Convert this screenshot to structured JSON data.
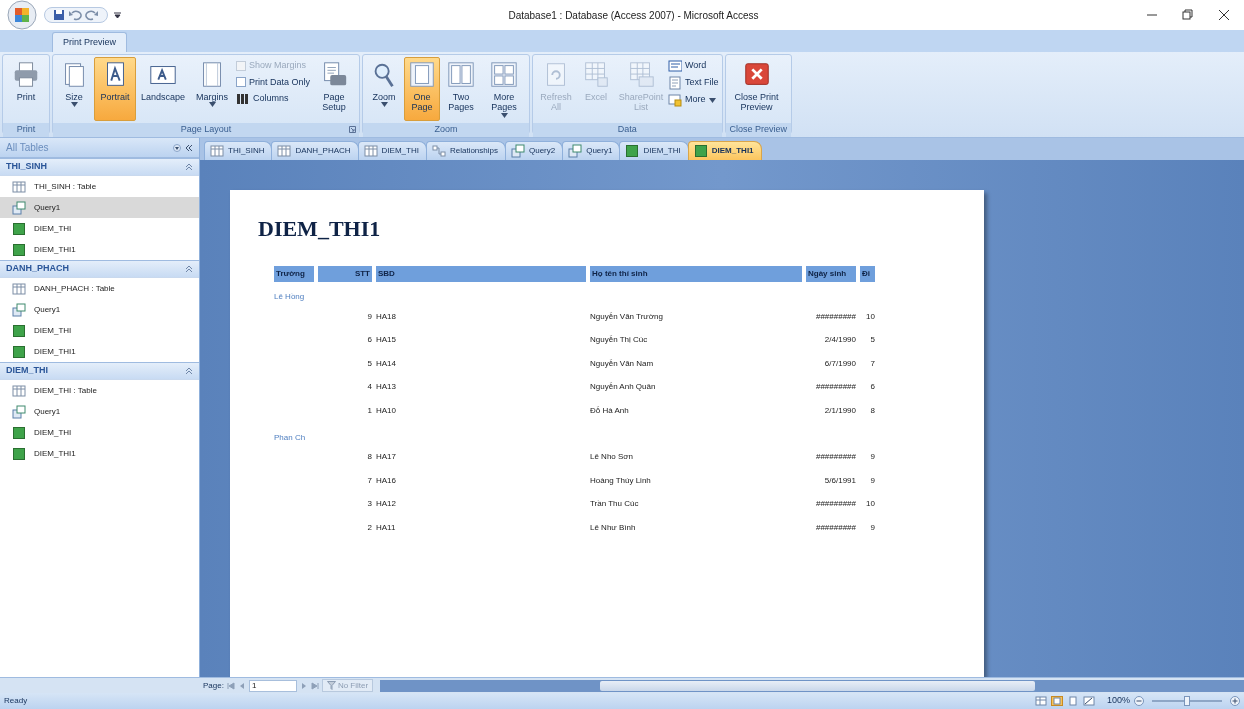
{
  "window": {
    "title": "Database1 : Database (Access 2007) - Microsoft Access"
  },
  "ribbon_tabs": [
    {
      "label": "Print Preview",
      "selected": true
    }
  ],
  "ribbon_groups": [
    {
      "label": "Print",
      "launcher": false,
      "items": [
        {
          "kind": "large",
          "label": "Print",
          "disabled": false,
          "selected": false,
          "dropdown": false
        }
      ]
    },
    {
      "label": "Page Layout",
      "launcher": true,
      "items": [
        {
          "kind": "large",
          "label": "Size",
          "disabled": false,
          "selected": false,
          "dropdown": true
        },
        {
          "kind": "large",
          "label": "Portrait",
          "disabled": false,
          "selected": true,
          "dropdown": false
        },
        {
          "kind": "large",
          "label": "Landscape",
          "disabled": false,
          "selected": false,
          "dropdown": false
        },
        {
          "kind": "large",
          "label": "Margins",
          "disabled": false,
          "selected": false,
          "dropdown": true
        },
        {
          "kind": "check",
          "label": "Show Margins",
          "disabled": true,
          "checked": false
        },
        {
          "kind": "check",
          "label": "Print Data Only",
          "disabled": false,
          "checked": false
        },
        {
          "kind": "small",
          "label": "Columns",
          "disabled": false,
          "dropdown": false
        },
        {
          "kind": "large",
          "label": "Page Setup",
          "disabled": false,
          "selected": false,
          "dropdown": false
        }
      ]
    },
    {
      "label": "Zoom",
      "launcher": false,
      "items": [
        {
          "kind": "large",
          "label": "Zoom",
          "disabled": false,
          "selected": false,
          "dropdown": true
        },
        {
          "kind": "large",
          "label": "One Page",
          "disabled": false,
          "selected": true,
          "dropdown": false
        },
        {
          "kind": "large",
          "label": "Two Pages",
          "disabled": false,
          "selected": false,
          "dropdown": false
        },
        {
          "kind": "large",
          "label": "More Pages",
          "disabled": false,
          "selected": false,
          "dropdown": true
        }
      ]
    },
    {
      "label": "Data",
      "launcher": false,
      "items": [
        {
          "kind": "large",
          "label": "Refresh All",
          "disabled": true,
          "selected": false,
          "dropdown": false
        },
        {
          "kind": "large",
          "label": "Excel",
          "disabled": true,
          "selected": false,
          "dropdown": false
        },
        {
          "kind": "large",
          "label": "SharePoint List",
          "disabled": true,
          "selected": false,
          "dropdown": false
        },
        {
          "kind": "small",
          "label": "Word",
          "disabled": false,
          "dropdown": false
        },
        {
          "kind": "small",
          "label": "Text File",
          "disabled": false,
          "dropdown": false
        },
        {
          "kind": "small",
          "label": "More",
          "disabled": false,
          "dropdown": true
        }
      ]
    },
    {
      "label": "Close Preview",
      "launcher": false,
      "items": [
        {
          "kind": "large",
          "label": "Close Print Preview",
          "disabled": false,
          "selected": false,
          "dropdown": false
        }
      ]
    }
  ],
  "nav_pane": {
    "title": "All Tables",
    "groups": [
      {
        "title": "THI_SINH",
        "items": [
          {
            "kind": "table",
            "label": "THI_SINH : Table",
            "selected": false
          },
          {
            "kind": "query",
            "label": "Query1",
            "selected": true
          },
          {
            "kind": "report",
            "label": "DIEM_THI",
            "selected": false
          },
          {
            "kind": "report",
            "label": "DIEM_THI1",
            "selected": false
          }
        ]
      },
      {
        "title": "DANH_PHACH",
        "items": [
          {
            "kind": "table",
            "label": "DANH_PHACH : Table",
            "selected": false
          },
          {
            "kind": "query",
            "label": "Query1",
            "selected": false
          },
          {
            "kind": "report",
            "label": "DIEM_THI",
            "selected": false
          },
          {
            "kind": "report",
            "label": "DIEM_THI1",
            "selected": false
          }
        ]
      },
      {
        "title": "DIEM_THI",
        "items": [
          {
            "kind": "table",
            "label": "DIEM_THI : Table",
            "selected": false
          },
          {
            "kind": "query",
            "label": "Query1",
            "selected": false
          },
          {
            "kind": "report",
            "label": "DIEM_THI",
            "selected": false
          },
          {
            "kind": "report",
            "label": "DIEM_THI1",
            "selected": false
          }
        ]
      }
    ]
  },
  "doc_tabs": [
    {
      "kind": "table",
      "label": "THI_SINH",
      "selected": false
    },
    {
      "kind": "table",
      "label": "DANH_PHACH",
      "selected": false
    },
    {
      "kind": "table",
      "label": "DIEM_THI",
      "selected": false
    },
    {
      "kind": "relationships",
      "label": "Relationships",
      "selected": false
    },
    {
      "kind": "query",
      "label": "Query2",
      "selected": false
    },
    {
      "kind": "query",
      "label": "Query1",
      "selected": false
    },
    {
      "kind": "report",
      "label": "DIEM_THI",
      "selected": false
    },
    {
      "kind": "report",
      "label": "DIEM_THI1",
      "selected": true
    }
  ],
  "report": {
    "title": "DIEM_THI1",
    "columns": [
      "Trường",
      "STT",
      "SBD",
      "Họ tên thí sinh",
      "Ngày sinh",
      "Đi"
    ],
    "groups": [
      {
        "name": "Lê Hồng",
        "rows": [
          [
            "9",
            "HA18",
            "Nguyễn Văn Trường",
            "#########",
            "10"
          ],
          [
            "6",
            "HA15",
            "Nguyễn Thị Cúc",
            "2/4/1990",
            "5"
          ],
          [
            "5",
            "HA14",
            "Nguyễn Văn Nam",
            "6/7/1990",
            "7"
          ],
          [
            "4",
            "HA13",
            "Nguyễn Anh Quân",
            "#########",
            "6"
          ],
          [
            "1",
            "HA10",
            "Đỗ Hà Anh",
            "2/1/1990",
            "8"
          ]
        ]
      },
      {
        "name": "Phan Ch",
        "rows": [
          [
            "8",
            "HA17",
            "Lê Nho Sơn",
            "#########",
            "9"
          ],
          [
            "7",
            "HA16",
            "Hoàng Thúy Linh",
            "5/6/1991",
            "9"
          ],
          [
            "3",
            "HA12",
            "Trần Thu Cúc",
            "#########",
            "10"
          ],
          [
            "2",
            "HA11",
            "Lê Như Bình",
            "#########",
            "9"
          ]
        ]
      }
    ]
  },
  "record_nav": {
    "label": "Page:",
    "value": "1",
    "filter": "No Filter"
  },
  "status_bar": {
    "text": "Ready",
    "zoom": "100%",
    "zoom_slider": {
      "level": 0.5
    }
  }
}
